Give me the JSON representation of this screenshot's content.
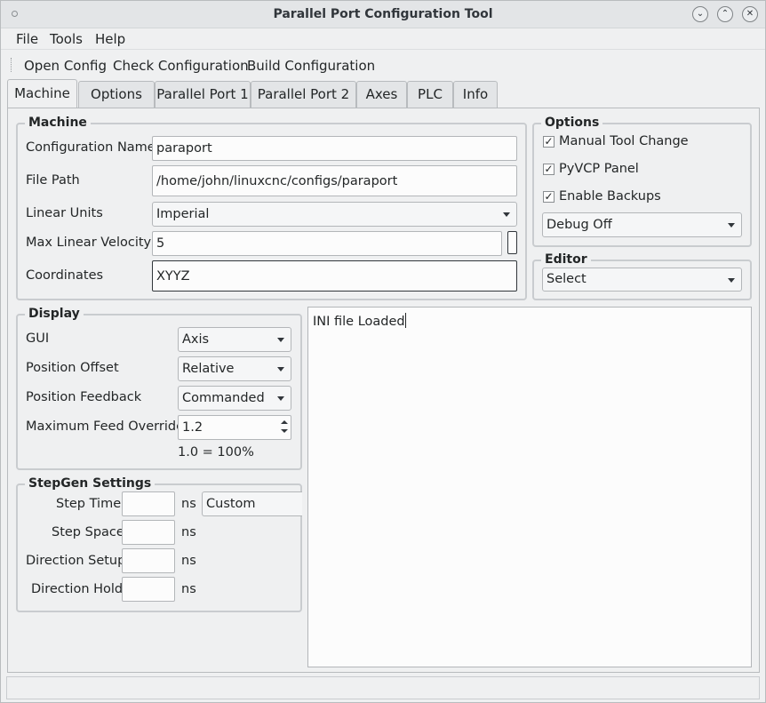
{
  "window": {
    "title": "Parallel Port Configuration Tool"
  },
  "menubar": {
    "items": [
      "File",
      "Tools",
      "Help"
    ]
  },
  "toolbar": {
    "buttons": [
      "Open Config",
      "Check Configuration",
      "Build Configuration"
    ]
  },
  "tabs": [
    "Machine",
    "Options",
    "Parallel Port 1",
    "Parallel Port 2",
    "Axes",
    "PLC",
    "Info"
  ],
  "active_tab": "Machine",
  "machine": {
    "title": "Machine",
    "config_name_label": "Configuration Name",
    "config_name_value": "paraport",
    "file_path_label": "File Path",
    "file_path_value": "/home/john/linuxcnc/configs/paraport",
    "linear_units_label": "Linear Units",
    "linear_units_value": "Imperial",
    "max_velocity_label": "Max Linear Velocity",
    "max_velocity_value": "5",
    "coordinates_label": "Coordinates",
    "coordinates_value": "XYYZ"
  },
  "options": {
    "title": "Options",
    "manual_tool_change": {
      "label": "Manual Tool Change",
      "checked": true
    },
    "pyvcp_panel": {
      "label": "PyVCP Panel",
      "checked": true
    },
    "enable_backups": {
      "label": "Enable Backups",
      "checked": true
    },
    "debug_value": "Debug Off"
  },
  "editor": {
    "title": "Editor",
    "value": "Select"
  },
  "display": {
    "title": "Display",
    "gui_label": "GUI",
    "gui_value": "Axis",
    "position_offset_label": "Position Offset",
    "position_offset_value": "Relative",
    "position_feedback_label": "Position Feedback",
    "position_feedback_value": "Commanded",
    "max_feed_override_label": "Maximum Feed Override",
    "max_feed_override_value": "1.2",
    "feed_note": "1.0 = 100%"
  },
  "stepgen": {
    "title": "StepGen Settings",
    "step_time_label": "Step Time",
    "step_space_label": "Step Space",
    "direction_setup_label": "Direction Setup",
    "direction_hold_label": "Direction Hold",
    "unit": "ns",
    "preset_value": "Custom"
  },
  "log": {
    "text": "INI file Loaded"
  },
  "colors": {
    "window_bg": "#eff0f1",
    "field_bg": "#fcfcfc",
    "border": "#c9cccf"
  }
}
